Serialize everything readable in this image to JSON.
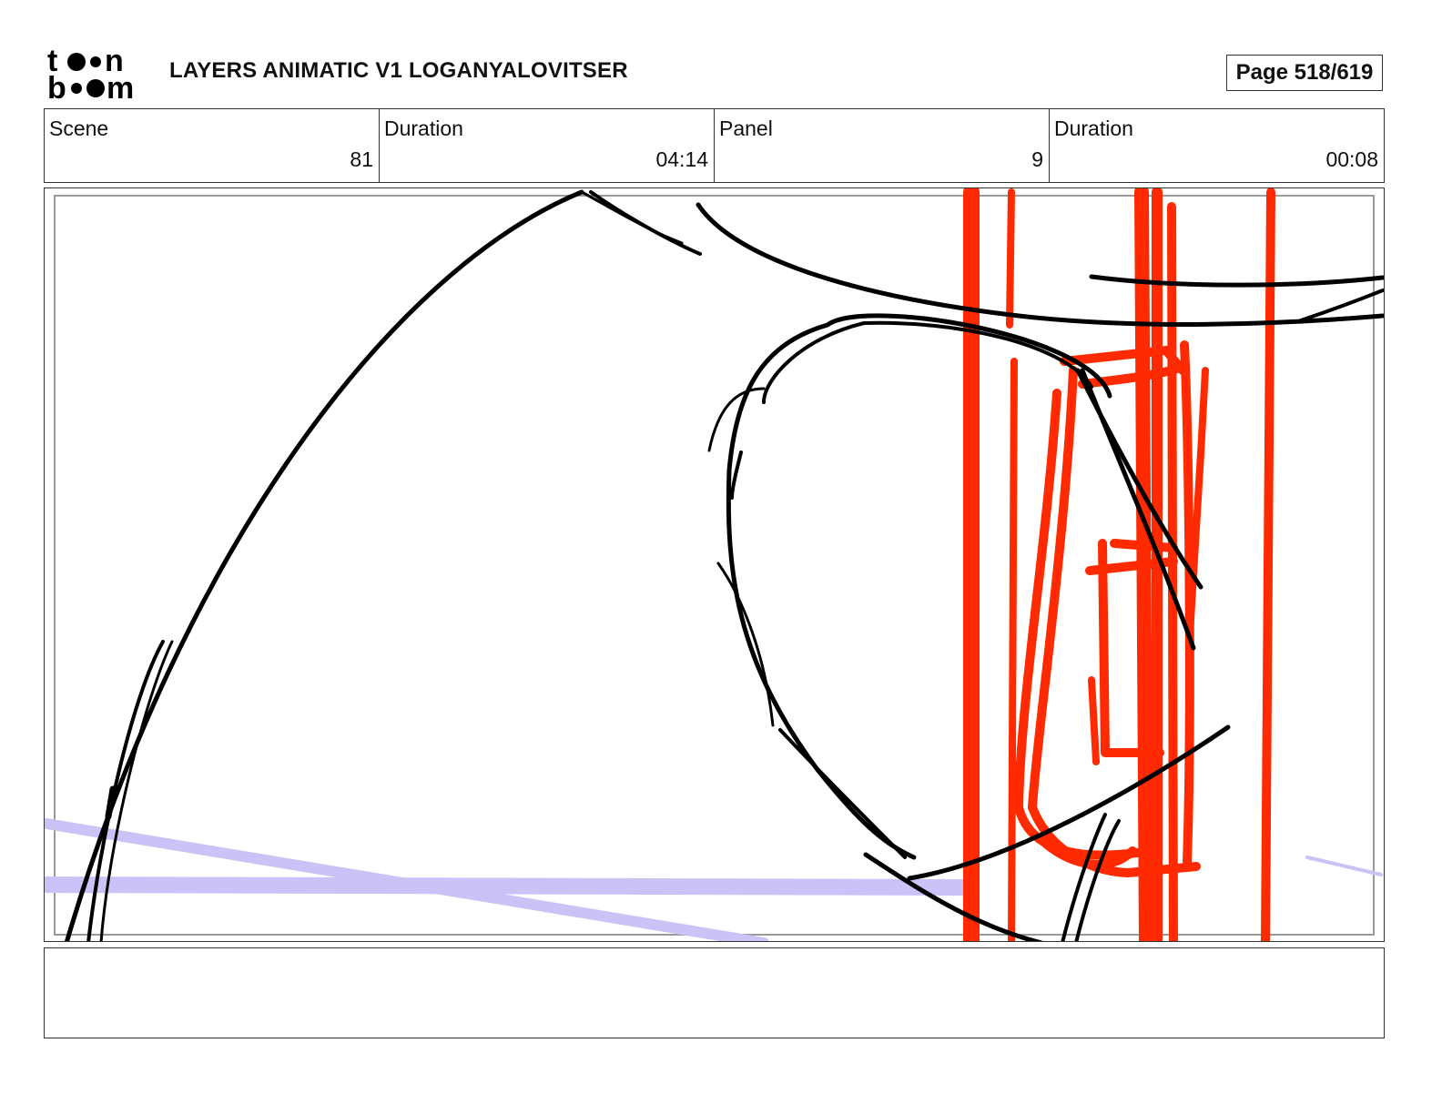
{
  "header": {
    "logo_line1": "toon",
    "logo_line2": "boom",
    "title": "LAYERS ANIMATIC V1 LOGANYALOVITSER",
    "page": "Page 518/619"
  },
  "info": [
    {
      "label": "Scene",
      "value": "81"
    },
    {
      "label": "Duration",
      "value": "04:14"
    },
    {
      "label": "Panel",
      "value": "9"
    },
    {
      "label": "Duration",
      "value": "00:08"
    }
  ],
  "panel": {
    "colors": {
      "ink": "#000000",
      "red": "#ff2a00",
      "lavender": "#c9c3f7",
      "frame": "#9a9a9a"
    }
  },
  "notes": {
    "text": ""
  }
}
